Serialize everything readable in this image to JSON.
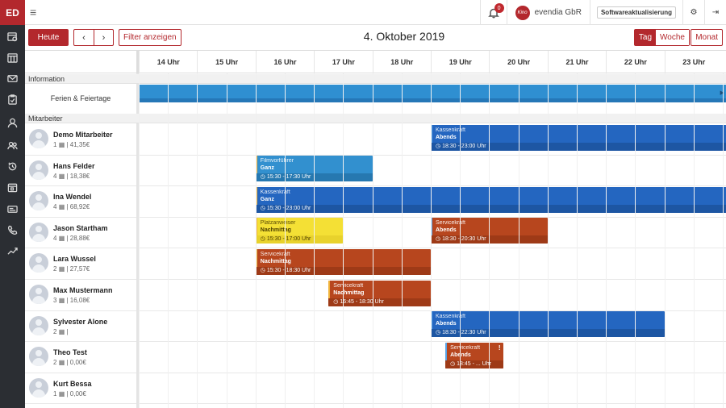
{
  "app": {
    "logo": "ED"
  },
  "topbar": {
    "menu_icon": "hamburger-icon",
    "notifications_count": "0",
    "company_logo_text": "Kino",
    "company_name": "evendia GbR",
    "update_button": "Softwareaktualisierung",
    "settings_icon": "gears-icon",
    "logout_icon": "logout-icon"
  },
  "sidebar": {
    "items": [
      {
        "icon": "clock-calendar-icon"
      },
      {
        "icon": "calendar-grid-icon"
      },
      {
        "icon": "mail-icon"
      },
      {
        "icon": "clipboard-icon"
      },
      {
        "icon": "user-icon"
      },
      {
        "icon": "users-icon"
      },
      {
        "icon": "history-icon"
      },
      {
        "icon": "calendar-icon"
      },
      {
        "icon": "id-card-icon"
      },
      {
        "icon": "phone-icon"
      },
      {
        "icon": "trend-icon"
      }
    ]
  },
  "toolbar": {
    "today_label": "Heute",
    "prev_label": "‹",
    "next_label": "›",
    "filter_label": "Filter anzeigen",
    "date_title": "4. Oktober 2019",
    "view_day": "Tag",
    "view_week": "Woche",
    "view_month": "Monat"
  },
  "hours": [
    "14 Uhr",
    "15 Uhr",
    "16 Uhr",
    "17 Uhr",
    "18 Uhr",
    "19 Uhr",
    "20 Uhr",
    "21 Uhr",
    "22 Uhr",
    "23 Uhr"
  ],
  "sections": {
    "information": "Information",
    "holiday_label": "Ferien & Feiertage",
    "staff": "Mitarbeiter"
  },
  "employees": [
    {
      "name": "Demo Mitarbeiter",
      "count": "1",
      "amount": "41,35€"
    },
    {
      "name": "Hans Felder",
      "count": "4",
      "amount": "18,38€"
    },
    {
      "name": "Ina Wendel",
      "count": "4",
      "amount": "68,92€"
    },
    {
      "name": "Jason Startham",
      "count": "4",
      "amount": "28,88€"
    },
    {
      "name": "Lara Wussel",
      "count": "2",
      "amount": "27,57€"
    },
    {
      "name": "Max Mustermann",
      "count": "3",
      "amount": "16,08€"
    },
    {
      "name": "Sylvester Alone",
      "count": "2",
      "amount": ""
    },
    {
      "name": "Theo Test",
      "count": "2",
      "amount": "0,00€"
    },
    {
      "name": "Kurt Bessa",
      "count": "1",
      "amount": "0,00€"
    }
  ],
  "shifts": [
    {
      "row": 0,
      "start": 18.0,
      "end": 23.5,
      "color": "blue",
      "edge": "#5aa3e6",
      "role": "Kassenkraft",
      "type": "Abends",
      "time": "18:30 - 23:00 Uhr"
    },
    {
      "row": 1,
      "start": 15.0,
      "end": 17.0,
      "color": "lblue",
      "edge": "#f0b23a",
      "role": "Filmvorführer",
      "type": "Ganz",
      "time": "15:30 - 17:30 Uhr"
    },
    {
      "row": 2,
      "start": 15.0,
      "end": 23.5,
      "color": "blue",
      "edge": "#f0b23a",
      "role": "Kassenkraft",
      "type": "Ganz",
      "time": "15:30 - 23:00 Uhr"
    },
    {
      "row": 3,
      "start": 15.0,
      "end": 16.5,
      "color": "yellow",
      "edge": "#f0b23a",
      "role": "Platzanweiser",
      "type": "Nachmittag",
      "time": "15:30 - 17:00 Uhr"
    },
    {
      "row": 3,
      "start": 18.0,
      "end": 20.0,
      "color": "orange",
      "edge": "#5aa3e6",
      "role": "Servicekraft",
      "type": "Abends",
      "time": "18:30 - 20:30 Uhr"
    },
    {
      "row": 4,
      "start": 15.0,
      "end": 18.0,
      "color": "orange",
      "edge": "#f0b23a",
      "role": "Servicekraft",
      "type": "Nachmittag",
      "time": "15:30 - 18:30 Uhr"
    },
    {
      "row": 5,
      "start": 16.25,
      "end": 18.0,
      "color": "orange",
      "edge": "#f0b23a",
      "role": "Servicekraft",
      "type": "Nachmittag",
      "time": "16:45 - 18:30 Uhr"
    },
    {
      "row": 6,
      "start": 18.0,
      "end": 22.0,
      "color": "blue",
      "edge": "#5aa3e6",
      "role": "Kassenkraft",
      "type": "Abends",
      "time": "18:30 - 22:30 Uhr"
    },
    {
      "row": 7,
      "start": 18.25,
      "end": 19.25,
      "color": "orange",
      "edge": "#5aa3e6",
      "role": "Servicekraft",
      "type": "Abends",
      "time": "18:45 - ... Uhr",
      "warn": "!"
    }
  ],
  "colors": {
    "brand": "#b3282d",
    "sidebar": "#2b2e33"
  }
}
